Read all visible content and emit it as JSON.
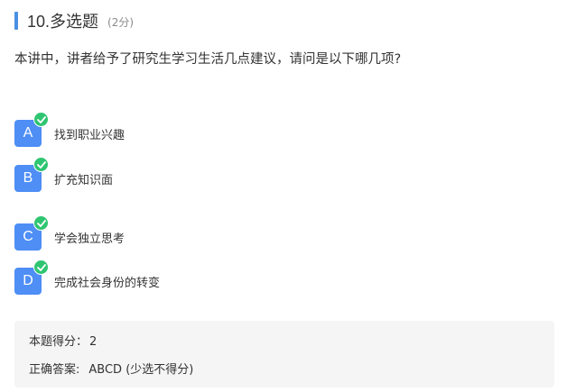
{
  "question": {
    "title": "10.多选题",
    "score": "(2分)",
    "stem": "本讲中，讲者给予了研究生学习生活几点建议，请问是以下哪几项?"
  },
  "options": [
    {
      "letter": "A",
      "text": "找到职业兴趣",
      "selected": true
    },
    {
      "letter": "B",
      "text": "扩充知识面",
      "selected": true
    },
    {
      "letter": "C",
      "text": "学会独立思考",
      "selected": true
    },
    {
      "letter": "D",
      "text": "完成社会身份的转变",
      "selected": true
    }
  ],
  "result": {
    "score_label": "本题得分：",
    "score_value": "2",
    "answer_label": "正确答案:",
    "answer_value": "ABCD (少选不得分)"
  },
  "colors": {
    "accent": "#4a90e2",
    "option_bg": "#4e8ef5",
    "check": "#2fc571",
    "answer_bg": "#f5f5f5"
  }
}
